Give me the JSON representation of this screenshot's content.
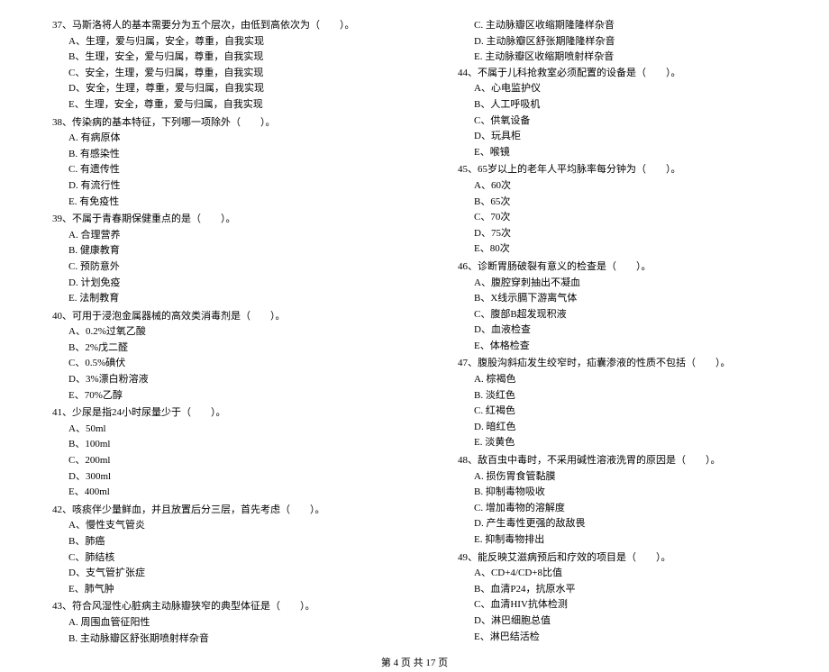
{
  "left": [
    {
      "num": "37、",
      "text": "马斯洛将人的基本需要分为五个层次，由低到高依次为（　　）。",
      "opts": [
        "A、生理，爱与归属，安全，尊重，自我实现",
        "B、生理，安全，爱与归属，尊重，自我实现",
        "C、安全，生理，爱与归属，尊重，自我实现",
        "D、安全，生理，尊重，爱与归属，自我实现",
        "E、生理，安全，尊重，爱与归属，自我实现"
      ]
    },
    {
      "num": "38、",
      "text": "传染病的基本特征，下列哪一项除外（　　）。",
      "opts": [
        "A. 有病原体",
        "B. 有感染性",
        "C. 有遗传性",
        "D. 有流行性",
        "E. 有免疫性"
      ]
    },
    {
      "num": "39、",
      "text": "不属于青春期保健重点的是（　　）。",
      "opts": [
        "A. 合理营养",
        "B. 健康教育",
        "C. 预防意外",
        "D. 计划免疫",
        "E. 法制教育"
      ]
    },
    {
      "num": "40、",
      "text": "可用于浸泡金属器械的高效类消毒剂是（　　）。",
      "opts": [
        "A、0.2%过氧乙酸",
        "B、2%戊二醛",
        "C、0.5%碘伏",
        "D、3%漂白粉溶液",
        "E、70%乙醇"
      ]
    },
    {
      "num": "41、",
      "text": "少尿是指24小时尿量少于（　　）。",
      "opts": [
        "A、50ml",
        "B、100ml",
        "C、200ml",
        "D、300ml",
        "E、400ml"
      ]
    },
    {
      "num": "42、",
      "text": "咳痰伴少量鲜血，并且放置后分三层，首先考虑（　　）。",
      "opts": [
        "A、慢性支气管炎",
        "B、肺癌",
        "C、肺结核",
        "D、支气管扩张症",
        "E、肺气肿"
      ]
    },
    {
      "num": "43、",
      "text": "符合风湿性心脏病主动脉瓣狭窄的典型体征是（　　）。",
      "opts": [
        "A. 周围血管征阳性",
        "B. 主动脉瓣区舒张期喷射样杂音"
      ]
    }
  ],
  "right_pre": [
    "C. 主动脉瓣区收缩期隆隆样杂音",
    "D. 主动脉瓣区舒张期隆隆样杂音",
    "E. 主动脉瓣区收缩期喷射样杂音"
  ],
  "right": [
    {
      "num": "44、",
      "text": "不属于儿科抢救室必须配置的设备是（　　）。",
      "opts": [
        "A、心电监护仪",
        "B、人工呼吸机",
        "C、供氧设备",
        "D、玩具柜",
        "E、喉镜"
      ]
    },
    {
      "num": "45、",
      "text": "65岁以上的老年人平均脉率每分钟为（　　）。",
      "opts": [
        "A、60次",
        "B、65次",
        "C、70次",
        "D、75次",
        "E、80次"
      ]
    },
    {
      "num": "46、",
      "text": "诊断胃肠破裂有意义的检查是（　　）。",
      "opts": [
        "A、腹腔穿刺抽出不凝血",
        "B、X线示膈下游离气体",
        "C、腹部B超发现积液",
        "D、血液检查",
        "E、体格检查"
      ]
    },
    {
      "num": "47、",
      "text": "腹股沟斜疝发生绞窄时，疝囊渗液的性质不包括（　　）。",
      "opts": [
        "A. 棕褐色",
        "B. 淡红色",
        "C. 红褐色",
        "D. 暗红色",
        "E. 淡黄色"
      ]
    },
    {
      "num": "48、",
      "text": "敌百虫中毒时，不采用碱性溶液洗胃的原因是（　　）。",
      "opts": [
        "A. 损伤胃食管黏膜",
        "B. 抑制毒物吸收",
        "C. 增加毒物的溶解度",
        "D. 产生毒性更强的敌敌畏",
        "E. 抑制毒物排出"
      ]
    },
    {
      "num": "49、",
      "text": "能反映艾滋病预后和疗效的项目是（　　）。",
      "opts": [
        "A、CD+4/CD+8比值",
        "B、血清P24，抗原水平",
        "C、血清HIV抗体检测",
        "D、淋巴细胞总值",
        "E、淋巴结活检"
      ]
    }
  ],
  "footer": "第 4 页 共 17 页"
}
